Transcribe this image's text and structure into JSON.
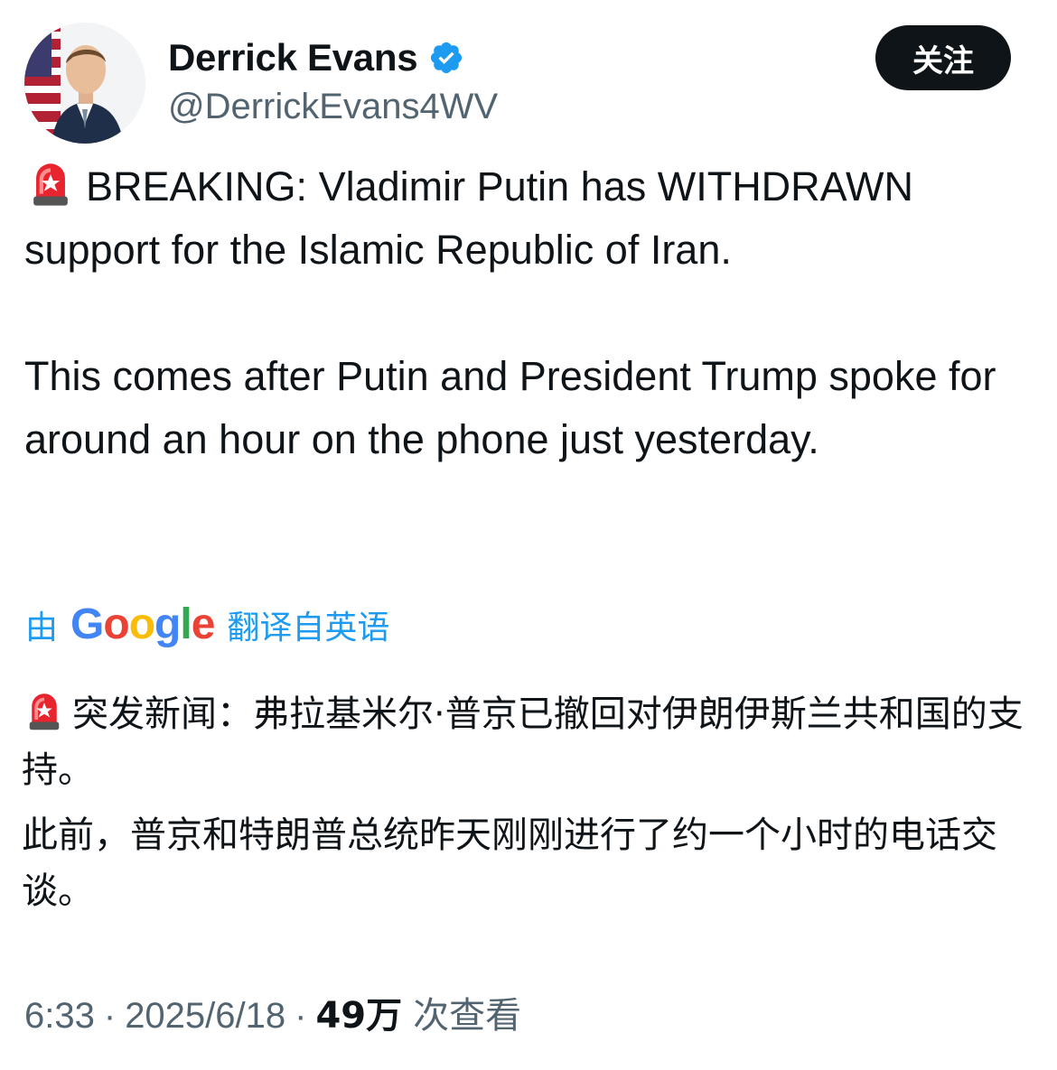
{
  "author": {
    "display_name": "Derrick Evans",
    "handle": "@DerrickEvans4WV",
    "verified": true,
    "avatar_icon": "profile-photo"
  },
  "follow_button": {
    "label": "关注"
  },
  "tweet": {
    "emoji_icon": "police-siren-icon",
    "paragraphs": [
      "BREAKING: Vladimir Putin has WITHDRAWN support for the Islamic Republic of Iran.",
      "This comes after Putin and President Trump spoke for around an hour on the phone just yesterday."
    ]
  },
  "translation": {
    "prefix": "由",
    "brand": "Google",
    "suffix": "翻译自英语",
    "paragraphs": [
      "突发新闻：弗拉基米尔·普京已撤回对伊朗伊斯兰共和国的支持。",
      "此前，普京和特朗普总统昨天刚刚进行了约一个小时的电话交谈。"
    ]
  },
  "meta": {
    "time": "6:33",
    "separator": "·",
    "date": "2025/6/18",
    "views_count": "49万",
    "views_label": "次查看"
  },
  "colors": {
    "text": "#0f1419",
    "secondary": "#536471",
    "link": "#1d9bf0",
    "verified": "#1d9bf0",
    "button_bg": "#0f1419"
  }
}
